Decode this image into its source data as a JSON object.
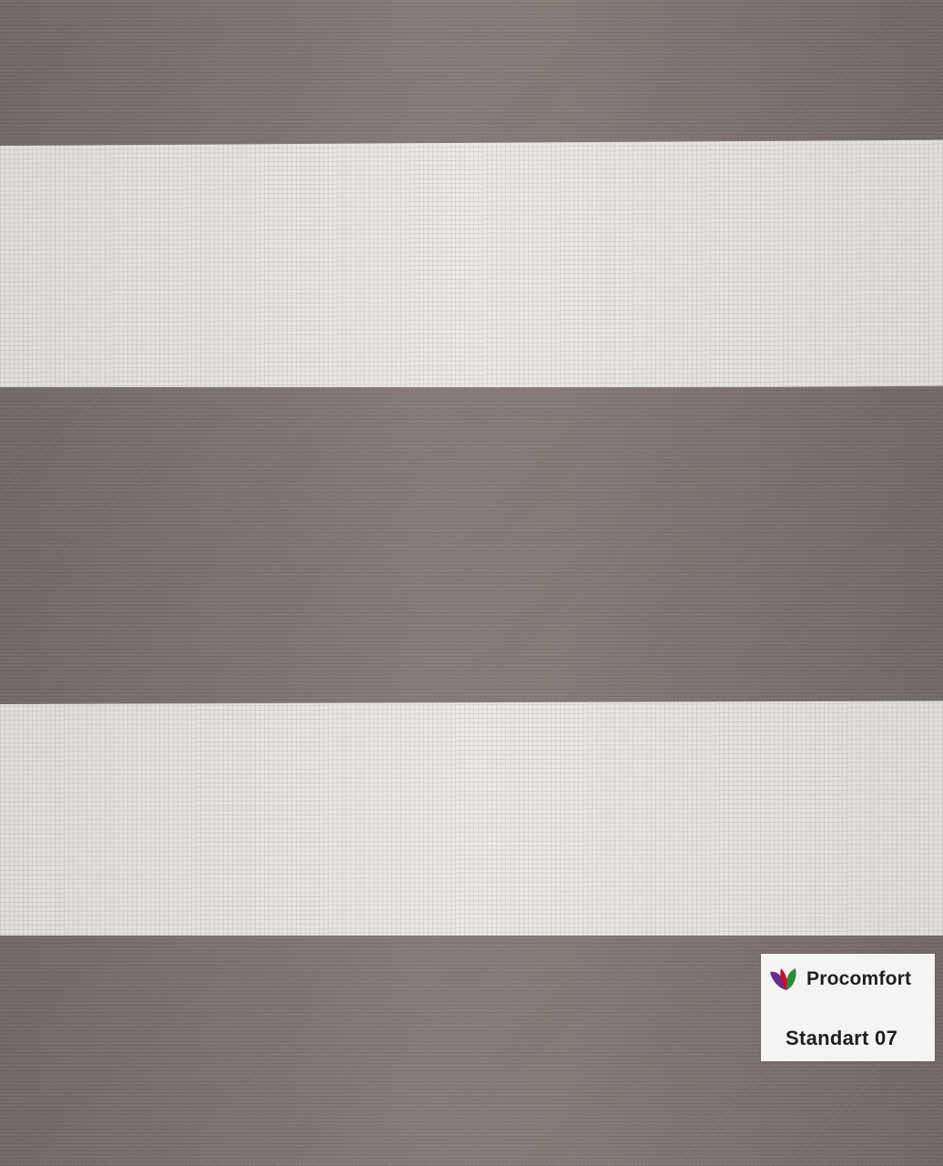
{
  "fabric": {
    "stripes": [
      {
        "tone": "dark",
        "color": "#7f7571"
      },
      {
        "tone": "light",
        "color": "#ebe8e3"
      },
      {
        "tone": "dark",
        "color": "#7f7571"
      },
      {
        "tone": "light",
        "color": "#ebe8e3"
      },
      {
        "tone": "dark",
        "color": "#7f7571"
      }
    ]
  },
  "label": {
    "brand": "Procomfort",
    "model": "Standart 07",
    "logo_icon": "leaf-logo-icon",
    "logo_colors": [
      "#6a2c8c",
      "#c8102e",
      "#2e8b3a"
    ]
  }
}
